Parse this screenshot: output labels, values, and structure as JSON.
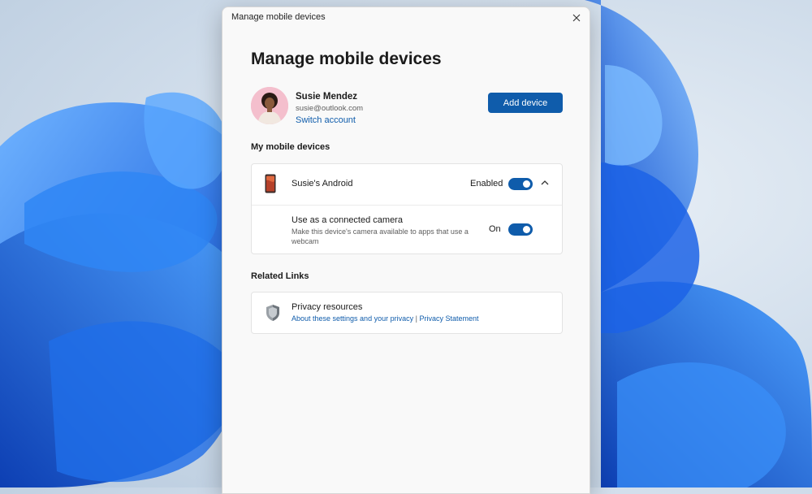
{
  "window": {
    "title": "Manage mobile devices"
  },
  "page": {
    "title": "Manage mobile devices"
  },
  "account": {
    "name": "Susie Mendez",
    "email": "susie@outlook.com",
    "switch_label": "Switch account",
    "add_device_label": "Add device"
  },
  "devices_section": {
    "label": "My mobile devices",
    "device": {
      "name": "Susie's Android",
      "status": "Enabled",
      "enabled": true,
      "expanded": true
    },
    "camera": {
      "title": "Use as a connected camera",
      "description": "Make this device's camera available to apps that use a webcam",
      "status": "On",
      "enabled": true
    }
  },
  "related_section": {
    "label": "Related Links",
    "privacy": {
      "title": "Privacy resources",
      "link1": "About these settings and your privacy",
      "separator": "|",
      "link2": "Privacy Statement"
    }
  },
  "icons": {
    "close": "close-icon",
    "phone": "phone-icon",
    "chevron": "chevron-up-icon",
    "shield": "shield-icon"
  },
  "colors": {
    "accent": "#0f5cab",
    "dialog_bg": "#f9f9f9",
    "card_bg": "#ffffff"
  }
}
